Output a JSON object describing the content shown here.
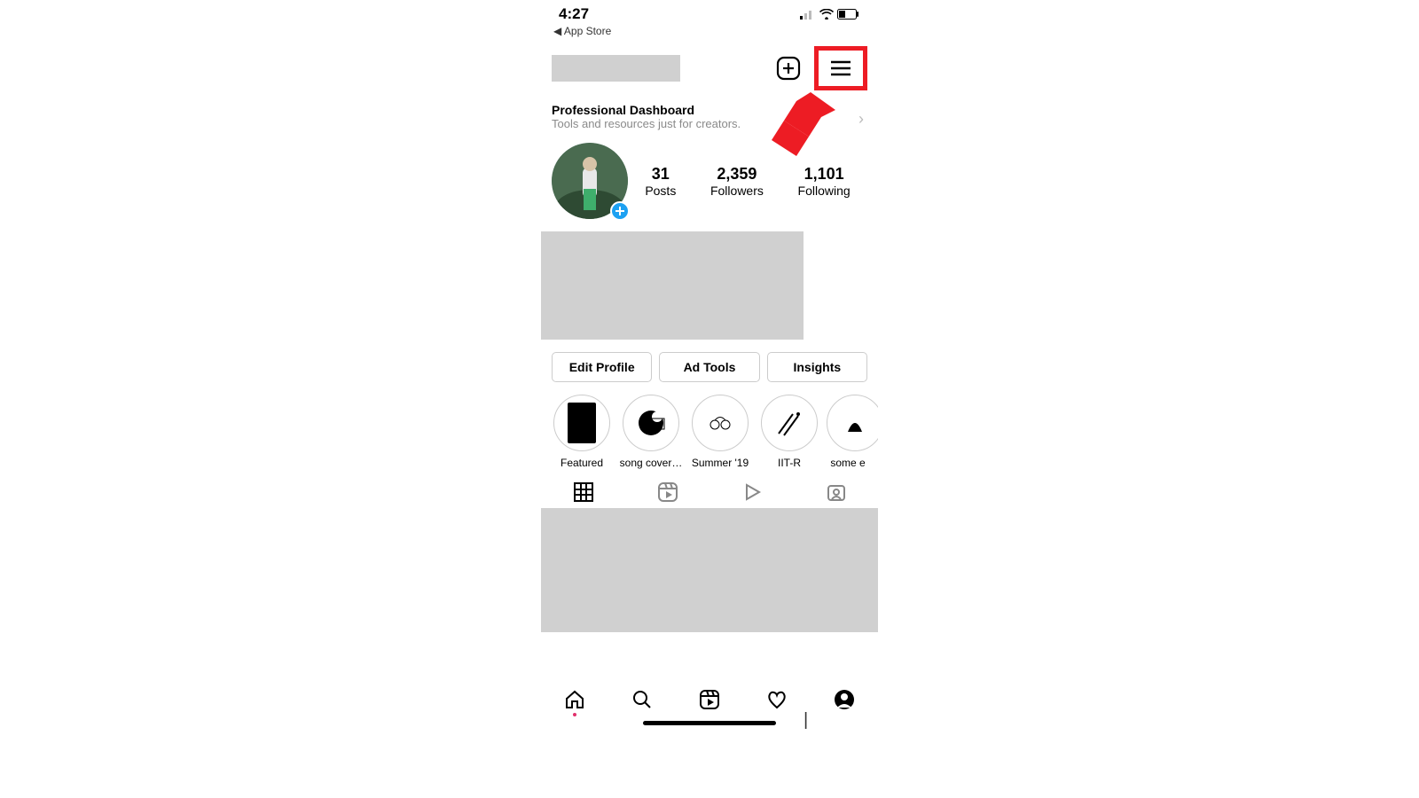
{
  "status": {
    "time": "4:27",
    "back_label": "App Store"
  },
  "header": {
    "add_icon": "plus-square-icon",
    "menu_icon": "hamburger-icon"
  },
  "dashboard": {
    "title": "Professional Dashboard",
    "subtitle": "Tools and resources just for creators."
  },
  "profile": {
    "stats": [
      {
        "value": "31",
        "label": "Posts"
      },
      {
        "value": "2,359",
        "label": "Followers"
      },
      {
        "value": "1,101",
        "label": "Following"
      }
    ]
  },
  "actions": {
    "edit": "Edit Profile",
    "ad": "Ad Tools",
    "insights": "Insights"
  },
  "highlights": [
    {
      "label": "Featured"
    },
    {
      "label": "song cover…"
    },
    {
      "label": "Summer '19"
    },
    {
      "label": "IIT-R"
    },
    {
      "label": "some e"
    }
  ],
  "annotation": {
    "target": "hamburger-menu"
  }
}
